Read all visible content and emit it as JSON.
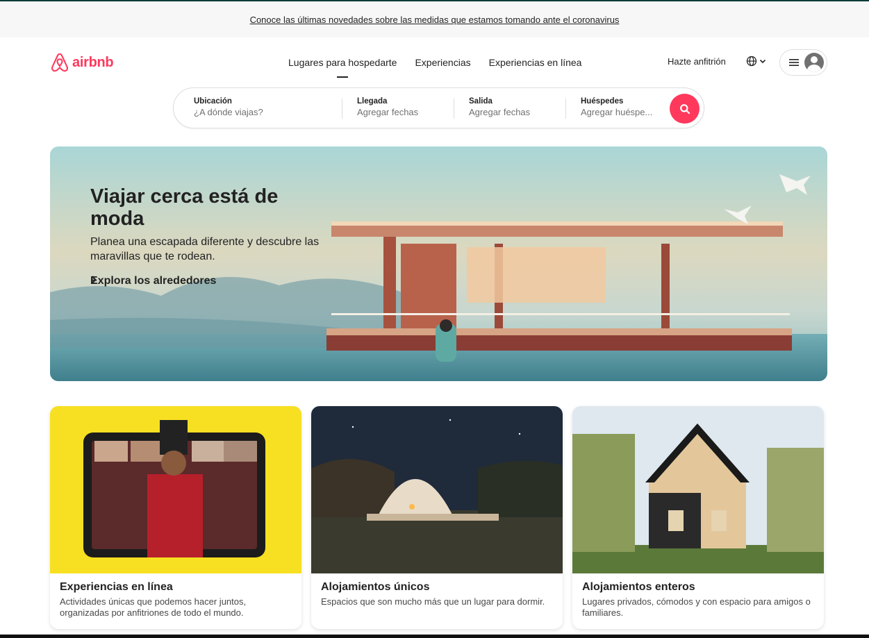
{
  "banner": {
    "link_text": "Conoce las últimas novedades sobre las medidas que estamos tomando ante el coronavirus"
  },
  "header": {
    "logo_text": "airbnb",
    "tabs": [
      {
        "label": "Lugares para hospedarte",
        "active": true
      },
      {
        "label": "Experiencias",
        "active": false
      },
      {
        "label": "Experiencias en línea",
        "active": false
      }
    ],
    "host_label": "Hazte anfitrión",
    "icons": {
      "language": "globe-icon",
      "menu": "hamburger-icon",
      "user": "user-avatar-icon"
    }
  },
  "search": {
    "location": {
      "label": "Ubicación",
      "placeholder": "¿A dónde viajas?"
    },
    "checkin": {
      "label": "Llegada",
      "value": "Agregar fechas"
    },
    "checkout": {
      "label": "Salida",
      "value": "Agregar fechas"
    },
    "guests": {
      "label": "Huéspedes",
      "value": "Agregar huéspe..."
    },
    "button_icon": "search-icon"
  },
  "hero": {
    "title": "Viajar cerca está de moda",
    "subtitle": "Planea una escapada diferente y descubre las maravillas que te rodean.",
    "link": "Explora los alrededores"
  },
  "cards": [
    {
      "title": "Experiencias en línea",
      "description": "Actividades únicas que podemos hacer juntos, organizadas por anfitriones de todo el mundo."
    },
    {
      "title": "Alojamientos únicos",
      "description": "Espacios que son mucho más que un lugar para dormir."
    },
    {
      "title": "Alojamientos enteros",
      "description": "Lugares privados, cómodos y con espacio para amigos o familiares."
    }
  ],
  "colors": {
    "brand": "#ff385c",
    "text": "#222222",
    "muted": "#717171",
    "banner_bg": "#f7f7f7"
  }
}
